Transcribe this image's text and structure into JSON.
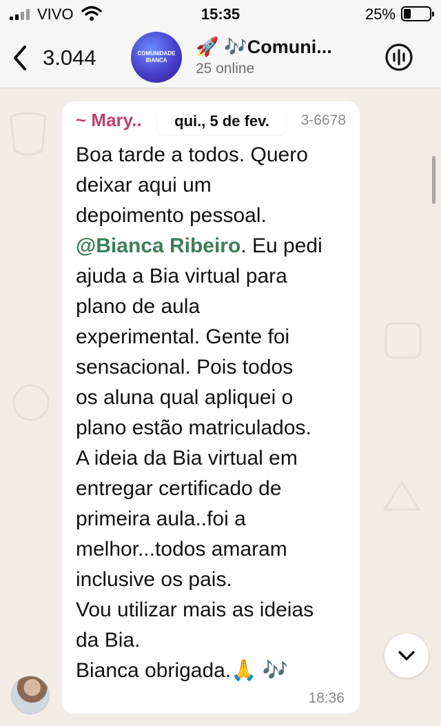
{
  "status_bar": {
    "carrier": "VIVO",
    "time": "15:35",
    "battery": "25%",
    "battery_level": 0.25
  },
  "header": {
    "back_count": "3.044",
    "group_avatar_line1": "COMUNIDADE",
    "group_avatar_line2": "BIANCA",
    "group_name": "🚀 🎶Comuni...",
    "group_status": "25 online"
  },
  "date_pill": "qui., 5 de fev.",
  "message": {
    "sender": "~ Mary..",
    "phone": "3-6678",
    "text_before_mention": "Boa tarde a todos. Quero\ndeixar aqui um\ndepoimento pessoal.\n",
    "mention": "@Bianca Ribeiro",
    "text_after_mention": ". Eu pedi\najuda a Bia virtual para\nplano de  aula\nexperimental. Gente foi\nsensacional. Pois todos\nos aluna qual apliquei o\nplano estão matriculados.\nA ideia da Bia virtual em\nentregar certificado de\nprimeira aula..foi a\nmelhor...todos amaram\ninclusive os pais.\nVou utilizar mais as ideias\nda Bia.\nBianca obrigada.🙏 🎶",
    "time": "18:36"
  },
  "colors": {
    "chat_background": "#f2ede4",
    "sender_color": "#c13f6a",
    "mention_color": "#3c7d57"
  }
}
